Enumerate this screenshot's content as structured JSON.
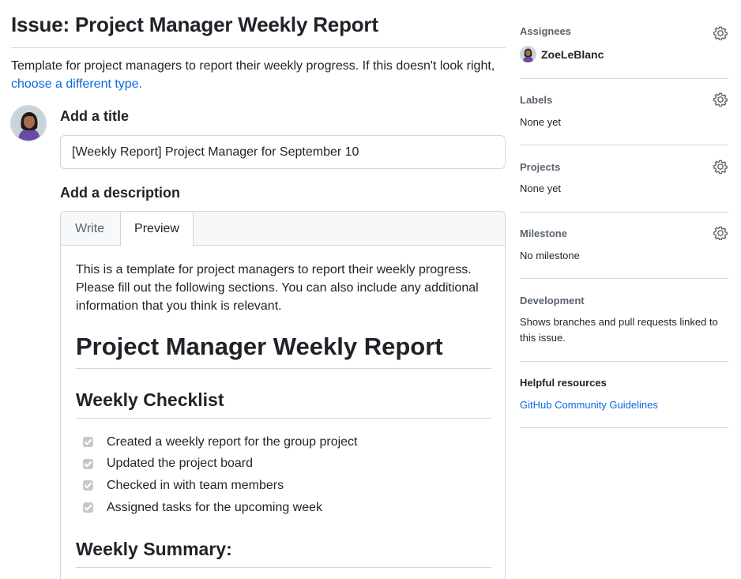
{
  "issue": {
    "page_title": "Issue: Project Manager Weekly Report",
    "intro_text": "Template for project managers to report their weekly progress. If this doesn't look right,",
    "intro_link": "choose a different type."
  },
  "form": {
    "title_label": "Add a title",
    "title_value": "[Weekly Report] Project Manager for September 10",
    "description_label": "Add a description",
    "tabs": [
      {
        "label": "Write"
      },
      {
        "label": "Preview"
      }
    ]
  },
  "preview": {
    "intro": "This is a template for project managers to report their weekly progress. Please fill out the following sections. You can also include any additional information that you think is relevant.",
    "heading": "Project Manager Weekly Report",
    "checklist_heading": "Weekly Checklist",
    "checklist": [
      {
        "label": "Created a weekly report for the group project",
        "checked": true
      },
      {
        "label": "Updated the project board",
        "checked": true
      },
      {
        "label": "Checked in with team members",
        "checked": true
      },
      {
        "label": "Assigned tasks for the upcoming week",
        "checked": true
      }
    ],
    "summary_heading": "Weekly Summary:"
  },
  "sidebar": {
    "assignees": {
      "heading": "Assignees",
      "user": "ZoeLeBlanc",
      "icon": "gear-icon"
    },
    "labels": {
      "heading": "Labels",
      "value": "None yet",
      "icon": "gear-icon"
    },
    "projects": {
      "heading": "Projects",
      "value": "None yet",
      "icon": "gear-icon"
    },
    "milestone": {
      "heading": "Milestone",
      "value": "No milestone",
      "icon": "gear-icon"
    },
    "development": {
      "heading": "Development",
      "value": "Shows branches and pull requests linked to this issue."
    },
    "resources": {
      "heading": "Helpful resources",
      "link": "GitHub Community Guidelines"
    }
  },
  "colors": {
    "link": "#0969da",
    "border": "#d0d7de",
    "muted": "#59636e",
    "text": "#1f2328"
  }
}
